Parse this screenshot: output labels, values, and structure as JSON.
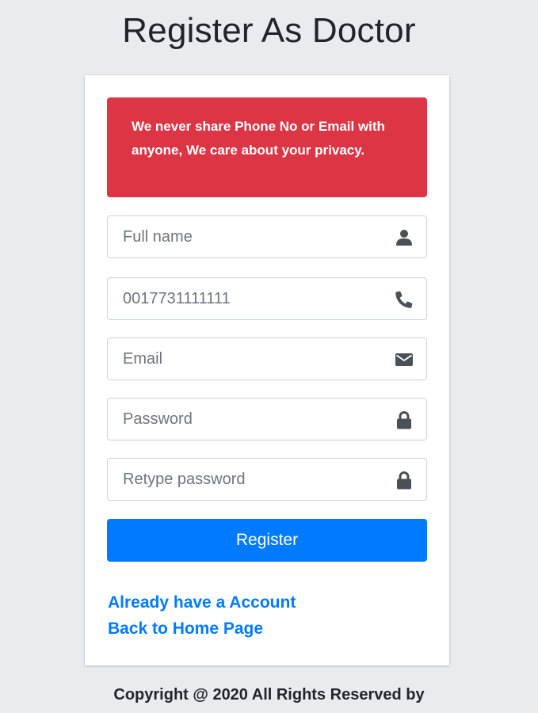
{
  "page": {
    "title": "Register As Doctor"
  },
  "alert": {
    "message": "We never share Phone No or Email with anyone, We care about your privacy.",
    "color": "#dc3545"
  },
  "form": {
    "full_name": {
      "placeholder": "Full name",
      "value": "",
      "icon": "user-icon"
    },
    "phone": {
      "placeholder": "",
      "value": "0017731111111",
      "icon": "phone-icon"
    },
    "email": {
      "placeholder": "Email",
      "value": "",
      "icon": "envelope-icon"
    },
    "password": {
      "placeholder": "Password",
      "value": "",
      "icon": "lock-icon"
    },
    "retype_password": {
      "placeholder": "Retype password",
      "value": "",
      "icon": "lock-icon"
    },
    "register_label": "Register",
    "accent_color": "#007bff"
  },
  "links": {
    "login": "Already have a Account",
    "home": "Back to Home Page"
  },
  "footer": {
    "copyright": "Copyright @ 2020 All Rights Reserved by"
  }
}
